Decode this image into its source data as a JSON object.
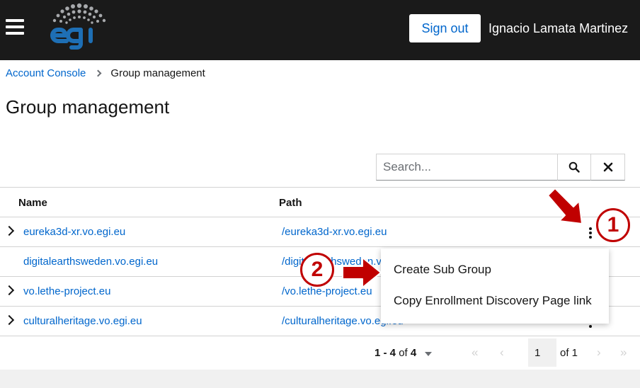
{
  "header": {
    "signout_label": "Sign out",
    "username": "Ignacio Lamata Martinez",
    "background_color": "#1a1a1a",
    "icons": [
      "hamburger-menu-icon",
      "egi-logo"
    ]
  },
  "breadcrumb": {
    "root": "Account Console",
    "current": "Group management"
  },
  "page": {
    "title": "Group management"
  },
  "search": {
    "placeholder": "Search...",
    "value": "",
    "search_icon": "search-icon",
    "clear_icon": "close-icon"
  },
  "table": {
    "columns": [
      "Name",
      "Path"
    ],
    "rows": [
      {
        "name": "eureka3d-xr.vo.egi.eu",
        "path": "/eureka3d-xr.vo.egi.eu",
        "expandable": true
      },
      {
        "name": "digitalearthsweden.vo.egi.eu",
        "path": "/digitalearthsweden.vo.egi.eu",
        "expandable": false
      },
      {
        "name": "vo.lethe-project.eu",
        "path": "/vo.lethe-project.eu",
        "expandable": true
      },
      {
        "name": "culturalheritage.vo.egi.eu",
        "path": "/culturalheritage.vo.egi.eu",
        "expandable": true
      }
    ]
  },
  "actions_menu": {
    "items": [
      "Create Sub Group",
      "Copy Enrollment Discovery Page link"
    ]
  },
  "pagination": {
    "range": "1 - 4",
    "of_label": "of",
    "total": "4",
    "current_page": "1",
    "of_pages": "of 1"
  },
  "annotations": {
    "step1": "1",
    "step2": "2",
    "color": "#c00000"
  },
  "colors": {
    "link": "#0066cc",
    "text": "#151515",
    "border": "#d2d2d2"
  }
}
